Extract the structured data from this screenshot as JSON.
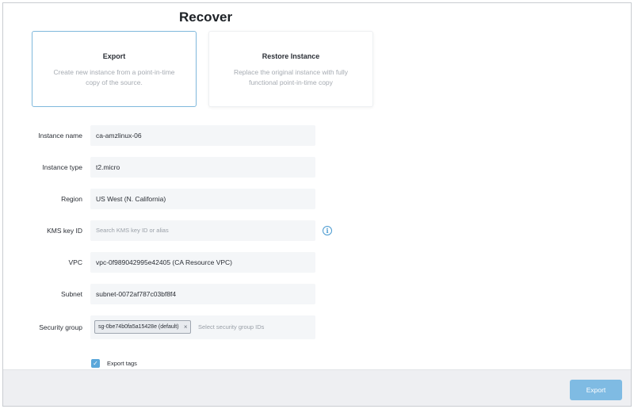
{
  "page": {
    "title": "Recover"
  },
  "options": [
    {
      "title": "Export",
      "description": "Create new instance from a point-in-time copy of the source."
    },
    {
      "title": "Restore Instance",
      "description": "Replace the original instance with fully functional point-in-time copy"
    }
  ],
  "form": {
    "instance_name": {
      "label": "Instance name",
      "value": "ca-amzlinux-06"
    },
    "instance_type": {
      "label": "Instance type",
      "value": "t2.micro"
    },
    "region": {
      "label": "Region",
      "value": "US West (N. California)"
    },
    "kms_key": {
      "label": "KMS key ID",
      "value": "",
      "placeholder": "Search KMS key ID or alias",
      "info_icon": "info-icon"
    },
    "vpc": {
      "label": "VPC",
      "value": "vpc-0f989042995e42405 (CA Resource VPC)"
    },
    "subnet": {
      "label": "Subnet",
      "value": "subnet-0072af787c03bf8f4"
    },
    "security_group": {
      "label": "Security group",
      "tags": [
        "sg-0be74b0fa5a15428e (default)"
      ],
      "placeholder": "Select security group IDs"
    },
    "export_tags": {
      "label": "Export tags",
      "checked": true
    }
  },
  "footer": {
    "export_label": "Export"
  },
  "colors": {
    "accent": "#5aa7da",
    "selected_border": "#7fb8dc",
    "button": "#7fbbe3",
    "field_bg": "#f4f6f8"
  }
}
